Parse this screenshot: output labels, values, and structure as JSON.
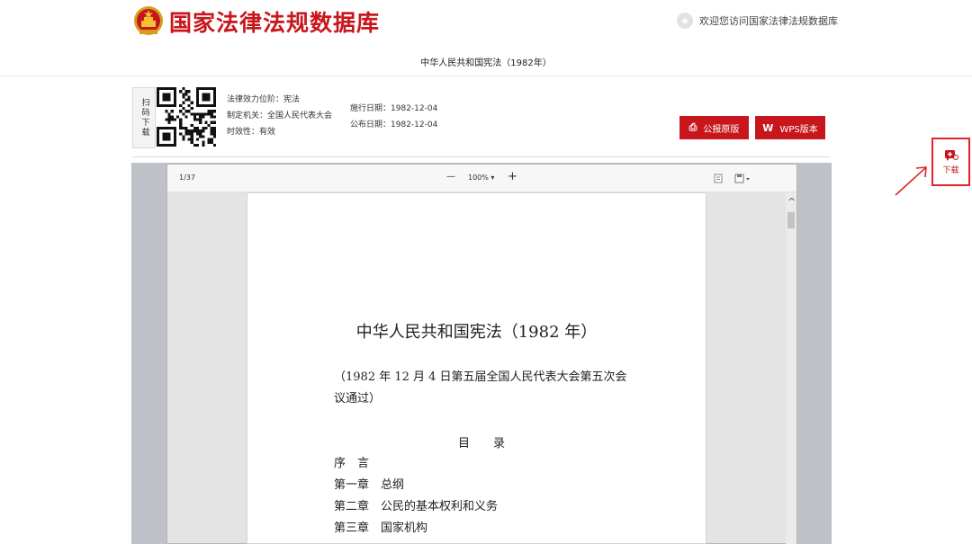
{
  "header": {
    "site_title": "国家法律法规数据库",
    "welcome": "欢迎您访问国家法律法规数据库"
  },
  "document": {
    "title": "中华人民共和国宪法（1982年）"
  },
  "info": {
    "scan_label": "扫码下载",
    "legal_level_label": "法律效力位阶：",
    "legal_level": "宪法",
    "authority_label": "制定机关：",
    "authority": "全国人民代表大会",
    "validity_label": "时效性：",
    "validity": "有效",
    "effective_label": "施行日期：",
    "effective_date": "1982-12-04",
    "publish_label": "公布日期：",
    "publish_date": "1982-12-04"
  },
  "buttons": {
    "gazette": "公报原版",
    "wps": "WPS版本"
  },
  "viewer": {
    "page_indicator": "1/37",
    "zoom": "100%",
    "zoom_caret": "▾",
    "zoom_out": "—",
    "zoom_in": "+",
    "scroll_up": "^"
  },
  "page_content": {
    "heading": "中华人民共和国宪法（1982 年）",
    "adoption_line1": "（1982 年 12 月 4 日第五届全国人民代表大会第五次会",
    "adoption_line2": "议通过）",
    "toc_title": "目　　录",
    "toc": [
      "序　言",
      "第一章　总纲",
      "第二章　公民的基本权利和义务",
      "第三章　国家机构"
    ]
  },
  "side_download": {
    "label": "下载"
  },
  "colors": {
    "brand_red": "#c8161d",
    "annotation_red": "#e0252b"
  }
}
